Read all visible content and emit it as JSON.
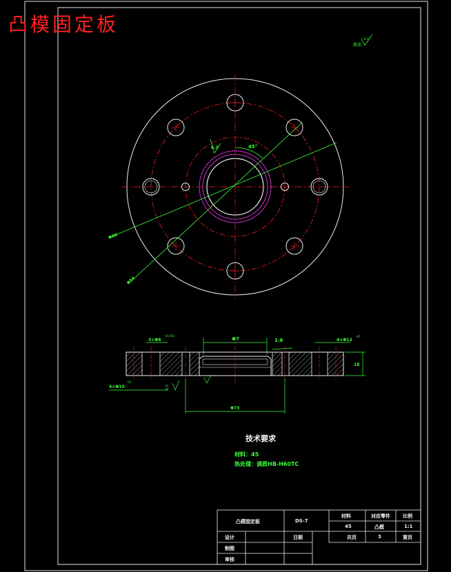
{
  "title": "凸模固定板",
  "surface_note": "其余",
  "surface_value": "3.2",
  "top_view": {
    "roughness": "6.3",
    "angle": "45°",
    "dim_a": "Φ80",
    "dim_b": "Φ54"
  },
  "section": {
    "dim_left_top": "3×Φ8",
    "dim_left_top_tol": "+0.018",
    "dim_left_bottom": "4×Φ10",
    "dim_left_bottom_tol": "H7",
    "dim_center_top": "Φ7",
    "dim_chamfer": "1.6",
    "dim_right_top": "4×Φ12",
    "dim_right_top_tol": "H7",
    "dim_bottom": "Φ73",
    "dim_height": "18",
    "fillet": "0.5"
  },
  "tech": {
    "title": "技术要求",
    "line1": "材料：45",
    "line2": "热处理：调质HB-H60TC"
  },
  "title_block": {
    "part_name": "凸模固定板",
    "drawing_no": "DS-7",
    "material_label": "材料",
    "material_value": "45",
    "group_label": "对应零件",
    "group_value": "凸模",
    "scale_label": "比例",
    "scale_value": "1:1",
    "quantity_label": "数量",
    "quantity_value": "3",
    "sheet_label": "共页",
    "sheet_value": "第页",
    "designer_label": "设计",
    "drafter_label": "制图",
    "checker_label": "审核",
    "date_label": "日期"
  }
}
